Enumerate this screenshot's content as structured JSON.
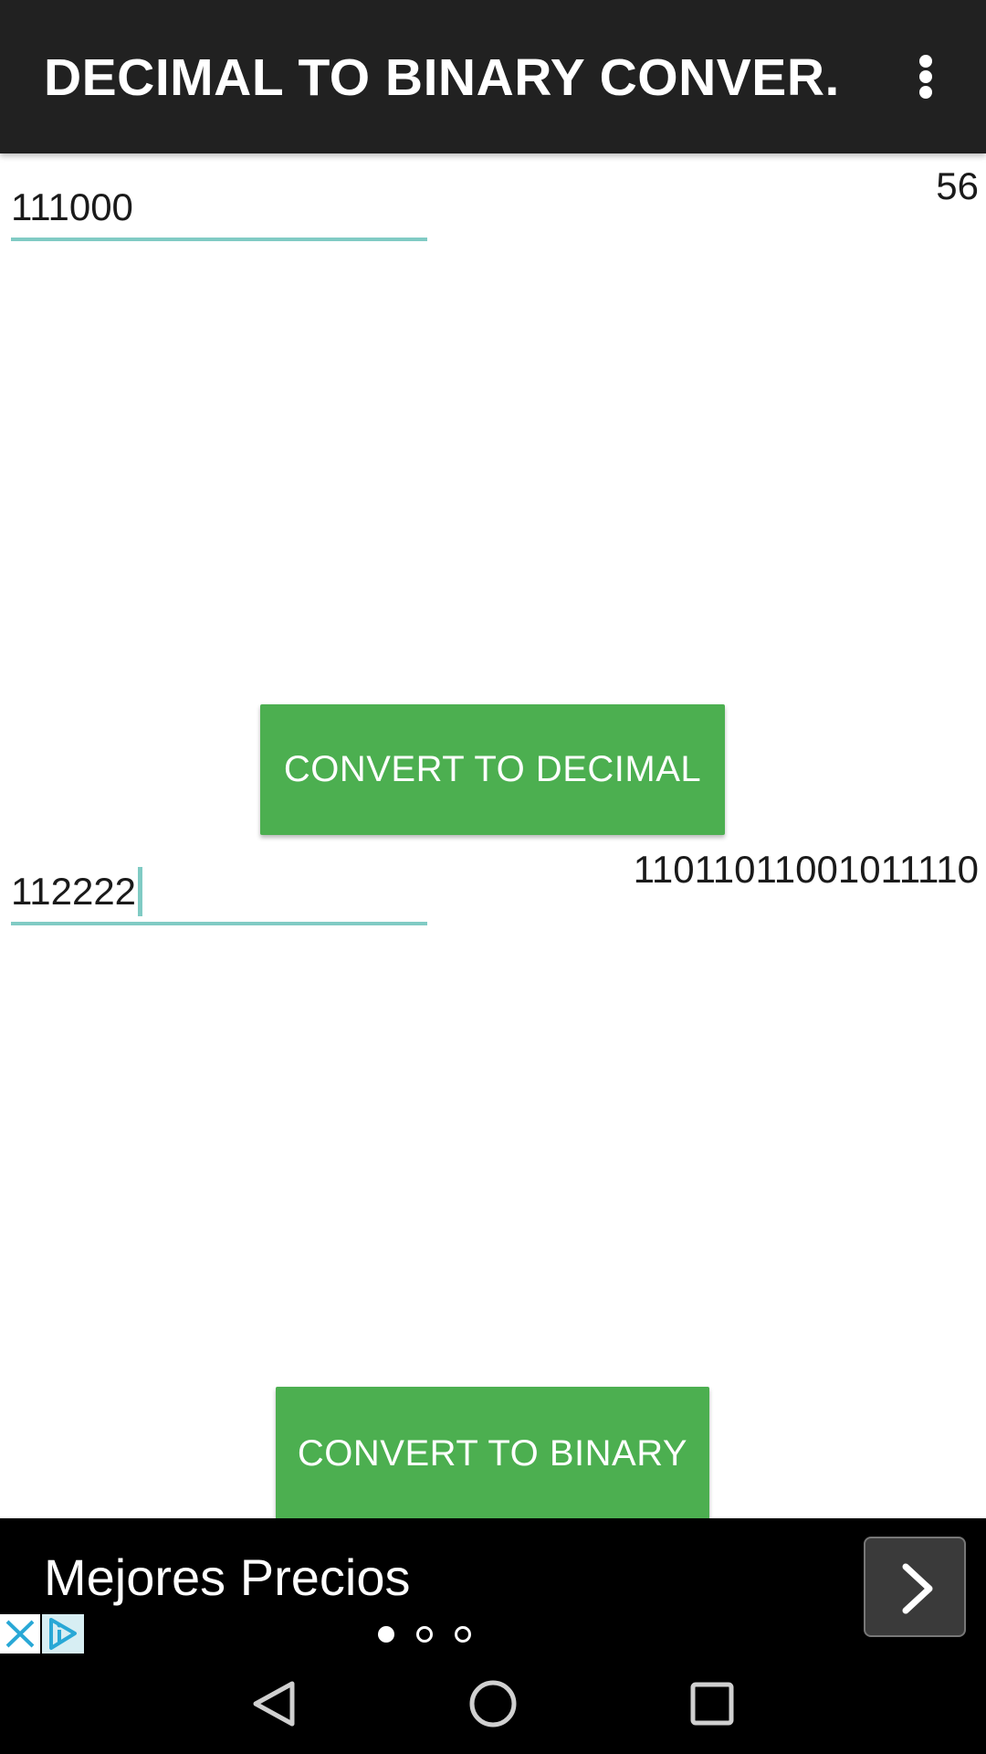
{
  "app_bar": {
    "title": "DECIMAL TO BINARY CONVER...",
    "menu_icon": "more-vert-icon"
  },
  "binary_to_decimal": {
    "input_value": "111000",
    "result": "56",
    "button_label": "CONVERT TO DECIMAL"
  },
  "decimal_to_binary": {
    "input_value": "112222",
    "result": "11011011001011110",
    "button_label": "CONVERT TO BINARY"
  },
  "ad_banner": {
    "text": "Mejores Precios",
    "arrow_icon": "chevron-right-icon",
    "close_icon": "close-icon",
    "adchoices_icon": "adchoices-icon",
    "carousel_page_index": 1,
    "carousel_page_count": 3
  },
  "nav_bar": {
    "icons": [
      "back-icon",
      "home-icon",
      "recents-icon"
    ]
  },
  "colors": {
    "app_bar": "#212121",
    "button": "#4caf50",
    "field_underline": "#80cbc4",
    "ad_background": "#000000"
  }
}
